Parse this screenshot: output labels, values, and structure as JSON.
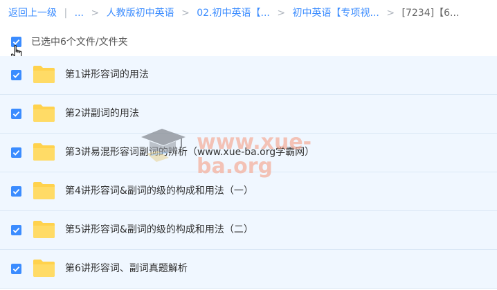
{
  "breadcrumb": {
    "back": "返回上一级",
    "divider": "|",
    "ellipsis": "...",
    "items": [
      "人教版初中英语",
      "02.初中英语【...",
      "初中英语【专项视..."
    ],
    "current": "[7234]【6..."
  },
  "selection": {
    "label": "已选中6个文件/文件夹"
  },
  "files": [
    {
      "name": "第1讲形容词的用法"
    },
    {
      "name": "第2讲副词的用法"
    },
    {
      "name": "第3讲易混形容词副词的辨析（www.xue-ba.org学霸网）"
    },
    {
      "name": "第4讲形容词&副词的级的构成和用法（一）"
    },
    {
      "name": "第5讲形容词&副词的级的构成和用法（二）"
    },
    {
      "name": "第6讲形容词、副词真题解析"
    }
  ],
  "watermark": {
    "text": "www.xue-ba.org"
  },
  "colors": {
    "accent": "#3b8cff",
    "row_bg": "#f0f7ff",
    "folder": "#ffd24d"
  }
}
